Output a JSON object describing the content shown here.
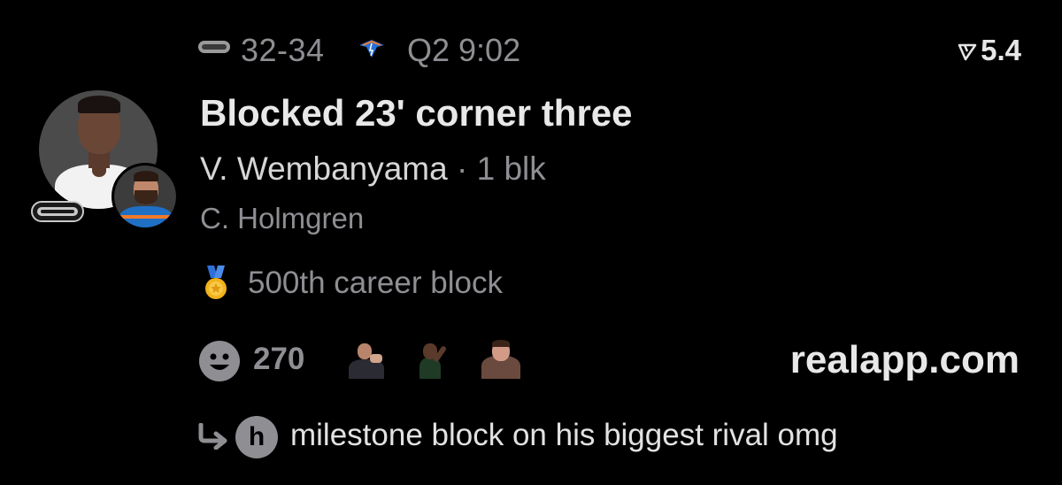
{
  "score_header": {
    "home_logo_icon": "spurs-logo-icon",
    "score": "32-34",
    "away_logo_icon": "thunder-logo-icon",
    "clock": "Q2 9:02",
    "rating_icon": "rating-arrow-icon",
    "rating": "5.4"
  },
  "play": {
    "headline": "Blocked 23' corner three",
    "player": "V. Wembanyama",
    "player_stat": " · 1 blk",
    "secondary_player": "C. Holmgren",
    "milestone_icon": "medal-icon",
    "milestone": "500th career block"
  },
  "avatars": {
    "primary": "wembanyama-avatar",
    "secondary": "holmgren-avatar",
    "badge": "spurs-badge-icon"
  },
  "reactions": {
    "icon": "smiley-icon",
    "count": "270",
    "reactors": [
      "reactor-avatar-1",
      "reactor-avatar-2",
      "reactor-avatar-3"
    ]
  },
  "brand": "realapp.com",
  "reply": {
    "icon": "reply-arrow-icon",
    "avatar_initial": "h",
    "text": "milestone block on his biggest rival omg"
  },
  "colors": {
    "background": "#000000",
    "primary_text": "#e6e6e6",
    "secondary_text": "#8e8e93",
    "medal_gold": "#f2b21b",
    "ribbon_blue": "#2f6fd8"
  }
}
